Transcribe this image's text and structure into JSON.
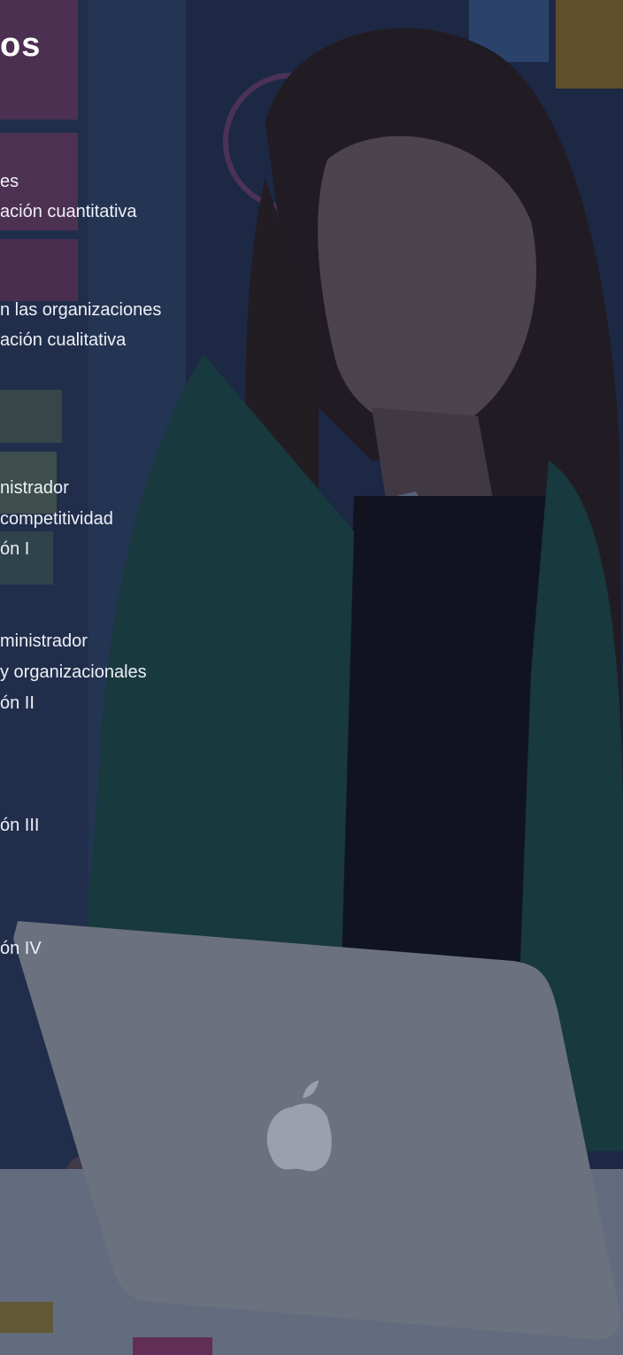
{
  "background": {
    "description_icon": "photo-woman-laptop",
    "overlay_color": "#121a30"
  },
  "heading": {
    "text": "os"
  },
  "courses": [
    {
      "text": "es"
    },
    {
      "text": "ación cuantitativa"
    },
    {
      "text": "n las organizaciones"
    },
    {
      "text": "ación cualitativa"
    },
    {
      "text": "nistrador"
    },
    {
      "text": "competitividad"
    },
    {
      "text": "ón I"
    },
    {
      "text": "ministrador"
    },
    {
      "text": "y organizacionales"
    },
    {
      "text": "ón II"
    },
    {
      "text": "ón III"
    },
    {
      "text": "ón IV"
    }
  ]
}
